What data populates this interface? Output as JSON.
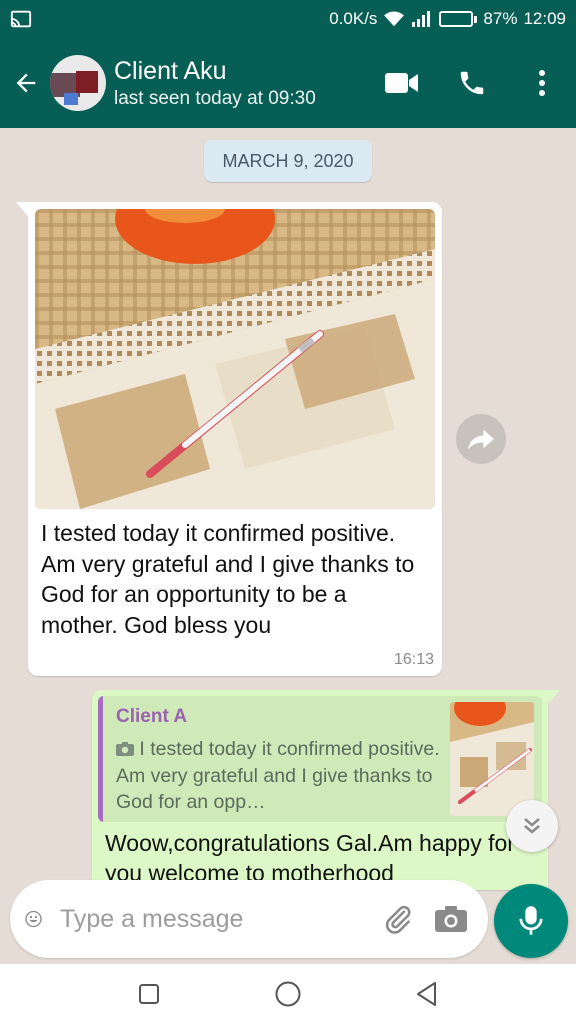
{
  "status_bar": {
    "network_speed": "0.0K/s",
    "battery_percent": "87%",
    "battery_level": 0.87,
    "time": "12:09"
  },
  "header": {
    "contact_name": "Client Aku",
    "last_seen": "last seen today at 09:30"
  },
  "chat": {
    "date_chip": "MARCH 9, 2020",
    "incoming": {
      "text": "I tested today it confirmed positive. Am very grateful and I give thanks to God for an opportunity to be  a mother. God bless you",
      "time": "16:13"
    },
    "outgoing": {
      "quote_name": "Client A",
      "quote_text": "I tested today it confirmed positive. Am very grateful and I give thanks to God for an opp…",
      "text": "Woow,congratulations Gal.Am happy for you welcome to motherhood"
    }
  },
  "composer": {
    "placeholder": "Type a message"
  },
  "colors": {
    "header": "#075e54",
    "chat_background": "#e5ddd5",
    "outgoing_bubble": "#dcf8c6",
    "mic_button": "#00897b"
  }
}
